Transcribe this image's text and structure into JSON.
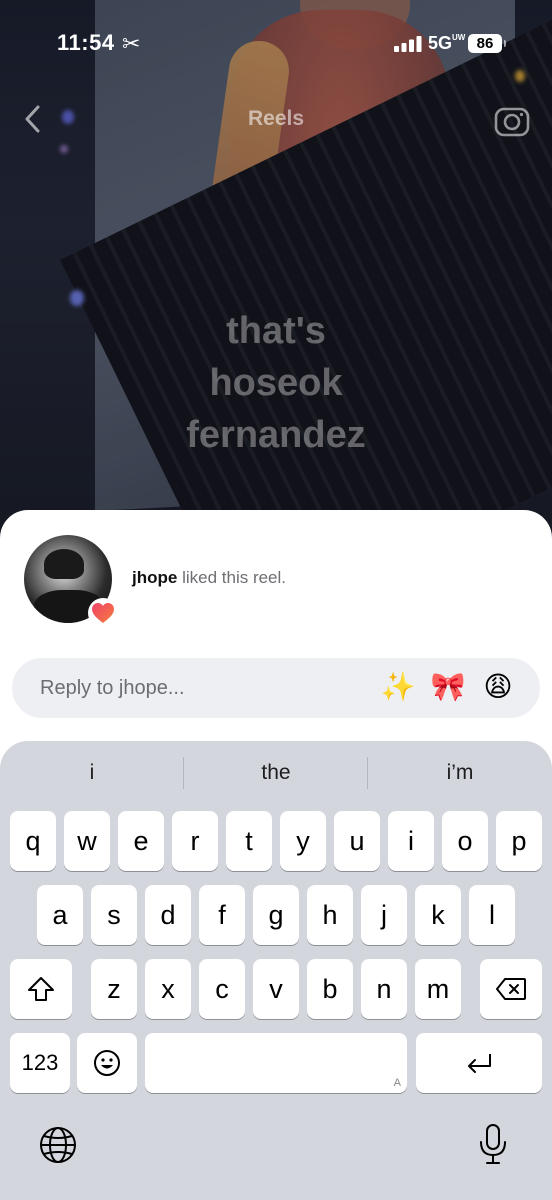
{
  "status_bar": {
    "time": "11:54",
    "network": "5G",
    "network_suffix": "UW",
    "battery": "86",
    "icons": [
      "scissors-icon",
      "signal-icon",
      "battery-icon"
    ]
  },
  "header": {
    "title": "Reels",
    "back_icon": "chevron-left-icon",
    "camera_icon": "camera-icon"
  },
  "reel": {
    "caption_lines": [
      "that's",
      "hoseok",
      "fernandez"
    ]
  },
  "notification": {
    "username": "jhope",
    "message": "liked this reel.",
    "badge_icon": "heart-icon"
  },
  "reply": {
    "placeholder": "Reply to jhope...",
    "quick_emojis": [
      "✨",
      "🎀",
      "😩"
    ]
  },
  "keyboard": {
    "suggestions": [
      "i",
      "the",
      "i’m"
    ],
    "row1": [
      "q",
      "w",
      "e",
      "r",
      "t",
      "y",
      "u",
      "i",
      "o",
      "p"
    ],
    "row2": [
      "a",
      "s",
      "d",
      "f",
      "g",
      "h",
      "j",
      "k",
      "l"
    ],
    "row3": [
      "z",
      "x",
      "c",
      "v",
      "b",
      "n",
      "m"
    ],
    "numbers_key": "123",
    "space_hint": "A",
    "icons": [
      "shift-icon",
      "delete-icon",
      "emoji-icon",
      "return-icon",
      "globe-icon",
      "microphone-icon"
    ]
  },
  "colors": {
    "sheet": "#ffffff",
    "keyboard": "#d3d6dc",
    "reply_box": "#eeeff2",
    "heart": "#ef3f57"
  }
}
